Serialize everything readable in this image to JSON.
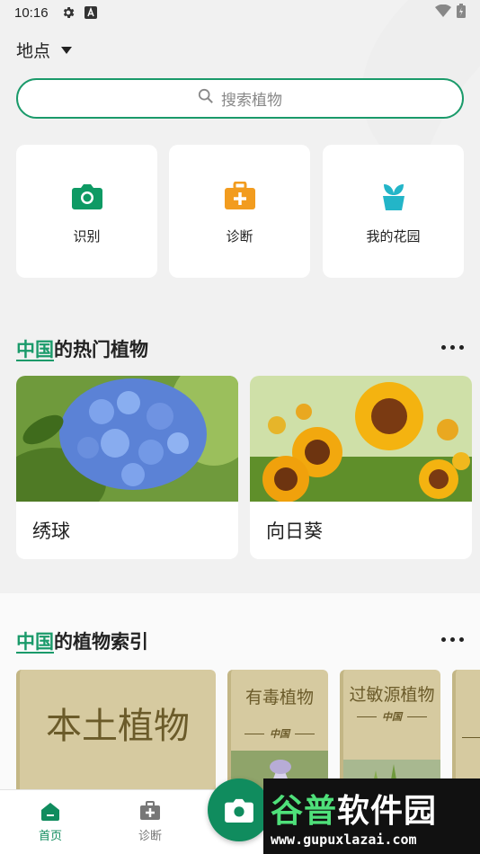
{
  "status_bar": {
    "time": "10:16"
  },
  "location": {
    "label": "地点"
  },
  "search": {
    "placeholder": "搜索植物"
  },
  "quick_actions": [
    {
      "label": "识别",
      "icon": "camera-icon",
      "color": "#0e9a64"
    },
    {
      "label": "诊断",
      "icon": "medkit-icon",
      "color": "#f29c1f"
    },
    {
      "label": "我的花园",
      "icon": "plant-pot-icon",
      "color": "#23b5c8"
    }
  ],
  "popular": {
    "title_highlight": "中国",
    "title_rest": "的热门植物",
    "cards": [
      {
        "name": "绣球"
      },
      {
        "name": "向日葵"
      }
    ]
  },
  "index": {
    "title_highlight": "中国",
    "title_rest": "的植物索引",
    "books": [
      {
        "title": "本土植物"
      },
      {
        "title": "有毒植物",
        "sub": "中国"
      },
      {
        "title": "过敏源植物",
        "sub": "中国"
      }
    ]
  },
  "bottom_nav": {
    "items": [
      {
        "label": "首页",
        "active": true
      },
      {
        "label": "诊断",
        "active": false
      }
    ],
    "accent": "#108c5e"
  },
  "watermark": {
    "text_a": "谷普",
    "text_b": "软件园",
    "url": "www.gupuxlazai.com"
  }
}
